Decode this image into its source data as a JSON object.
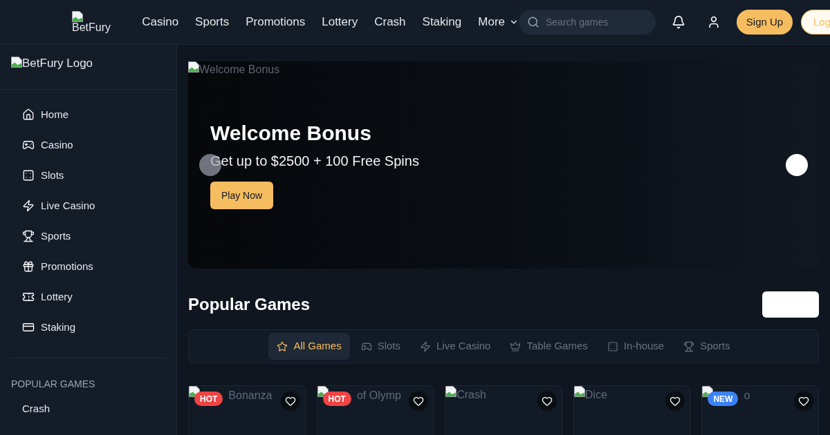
{
  "header": {
    "logo_alt": "BetFury",
    "nav": [
      {
        "label": "Casino",
        "kind": "link"
      },
      {
        "label": "Sports",
        "kind": "link"
      },
      {
        "label": "Promotions",
        "kind": "link"
      },
      {
        "label": "Lottery",
        "kind": "link"
      },
      {
        "label": "Crash",
        "kind": "link"
      },
      {
        "label": "Staking",
        "kind": "link"
      },
      {
        "label": "More",
        "kind": "dropdown"
      }
    ],
    "search": {
      "placeholder": "Search games"
    },
    "buttons": [
      {
        "label": "Sign Up",
        "kind": "primary"
      },
      {
        "label": "Log",
        "kind": "outline"
      }
    ]
  },
  "sidebar": {
    "logo_alt": "BetFury Logo",
    "items": [
      {
        "label": "Home"
      },
      {
        "label": "Casino"
      },
      {
        "label": "Slots"
      },
      {
        "label": "Live Casino"
      },
      {
        "label": "Sports"
      },
      {
        "label": "Promotions"
      },
      {
        "label": "Lottery"
      },
      {
        "label": "Staking"
      }
    ],
    "section_title": "POPULAR GAMES",
    "section_items": [
      {
        "label": "Crash"
      }
    ]
  },
  "banner": {
    "image_alt": "Welcome Bonus",
    "title": "Welcome Bonus",
    "subtitle": "Get up to $2500 + 100 Free Spins",
    "button": "Play Now",
    "carousel": {
      "previous": {
        "disabled": true
      },
      "next": {
        "disabled": false
      }
    }
  },
  "popular": {
    "title": "Popular Games",
    "tabs": [
      {
        "label": "All Games",
        "selected": true
      },
      {
        "label": "Slots",
        "selected": false
      },
      {
        "label": "Live Casino",
        "selected": false
      },
      {
        "label": "Table Games",
        "selected": false
      },
      {
        "label": "In-house",
        "selected": false
      },
      {
        "label": "Sports",
        "selected": false
      }
    ],
    "games": [
      {
        "image_alt": "Bonanza",
        "badge": {
          "label": "HOT",
          "color": "#ef4444"
        },
        "favorite": false
      },
      {
        "image_alt": "of Olymp",
        "badge": {
          "label": "HOT",
          "color": "#ef4444"
        },
        "favorite": false
      },
      {
        "image_alt": "Crash",
        "favorite": false
      },
      {
        "image_alt": "Dice",
        "favorite": false
      },
      {
        "image_alt": "o",
        "badge": {
          "label": "NEW",
          "color": "#3b82f6"
        },
        "favorite": false
      }
    ]
  }
}
